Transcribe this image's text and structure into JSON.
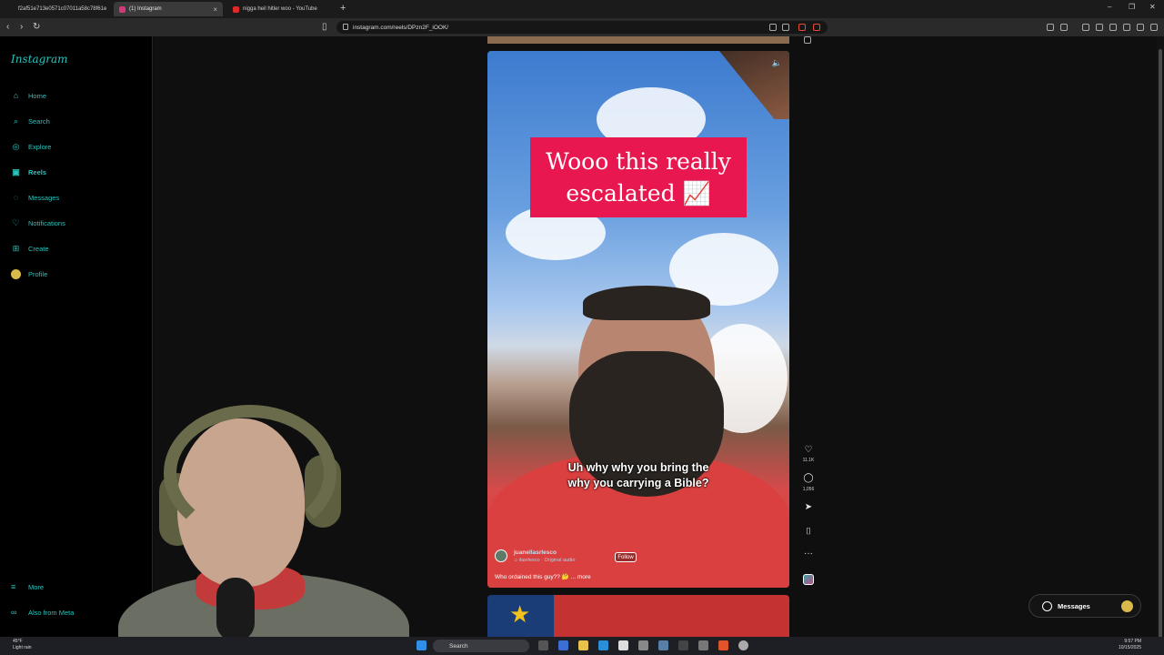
{
  "browser": {
    "tabs": [
      {
        "label": "f2af51e713e0571c07011a58c78f61e",
        "active": false
      },
      {
        "label": "(1) Instagram",
        "active": true
      },
      {
        "label": "nigga heil hitler woo - YouTube",
        "active": false
      }
    ],
    "url": "instagram.com/reels/DPzn2F_iOOK/"
  },
  "sidebar": {
    "logo": "Instagram",
    "items": [
      {
        "label": "Home",
        "icon": "home-icon"
      },
      {
        "label": "Search",
        "icon": "search-icon"
      },
      {
        "label": "Explore",
        "icon": "compass-icon"
      },
      {
        "label": "Reels",
        "icon": "reels-icon"
      },
      {
        "label": "Messages",
        "icon": "messenger-icon"
      },
      {
        "label": "Notifications",
        "icon": "heart-icon"
      },
      {
        "label": "Create",
        "icon": "plus-icon"
      },
      {
        "label": "Profile",
        "icon": "avatar"
      }
    ],
    "more": "More",
    "also_from_meta": "Also from Meta"
  },
  "reel": {
    "overlay_text_line1": "Wooo this really",
    "overlay_text_line2": "escalated 📈",
    "subtitle_line1": "Uh why why you bring the",
    "subtitle_line2": "why you carrying a Bible?",
    "username": "juanellasrlesco",
    "audio": "♫ ilasrlesco · Original audio",
    "follow_label": "Follow",
    "description": "Who ordained this guy?? 🤔 ... more"
  },
  "actions": {
    "likes": "11.1K",
    "comments": "1,056"
  },
  "messages_pill": {
    "label": "Messages"
  },
  "taskbar": {
    "weather_temp": "45°F",
    "weather_desc": "Light rain",
    "search_label": "Search",
    "time": "9:57 PM",
    "date": "10/15/2025"
  },
  "colors": {
    "accent": "#29c4bc",
    "caption_bg": "#e8174f"
  }
}
